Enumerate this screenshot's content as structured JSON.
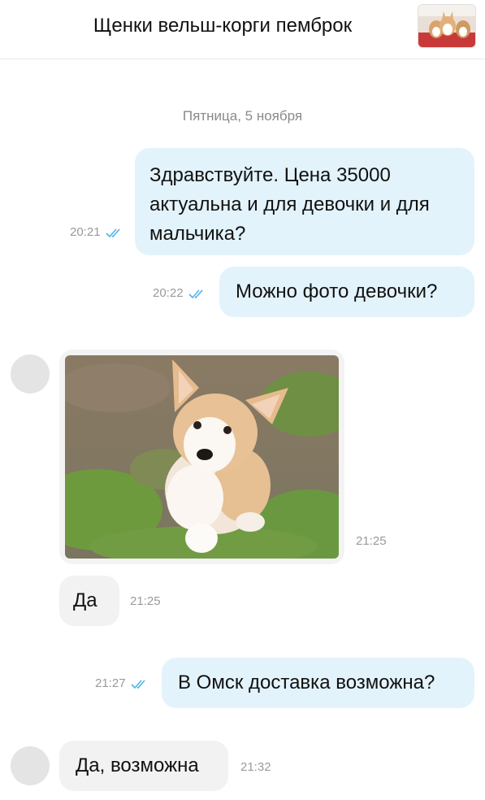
{
  "header": {
    "title": "Щенки вельш-корги пемброк",
    "thumb_icon": "corgi-listing-thumbnail"
  },
  "date_separator": "Пятница, 5 ноября",
  "messages": [
    {
      "direction": "out",
      "lines": [
        "Здравствуйте. Цена 35000",
        "актуальна и для девочки и для",
        "мальчика?"
      ],
      "time": "20:21",
      "read": true
    },
    {
      "direction": "out",
      "text": "Можно фото девочки?",
      "time": "20:22",
      "read": true
    },
    {
      "direction": "in",
      "type": "photo",
      "photo_icon": "corgi-puppy-photo",
      "time": "21:25"
    },
    {
      "direction": "in",
      "text": "Да",
      "time": "21:25"
    },
    {
      "direction": "out",
      "text": "В Омск доставка возможна?",
      "time": "21:27",
      "read": true
    },
    {
      "direction": "in",
      "text": "Да, возможна",
      "time": "21:32"
    }
  ],
  "colors": {
    "outgoing_bubble": "#e3f3fb",
    "incoming_bubble": "#f2f2f2",
    "read_ticks": "#4db5e6",
    "time": "#9a9a9a",
    "avatar": "#e4e4e4"
  }
}
